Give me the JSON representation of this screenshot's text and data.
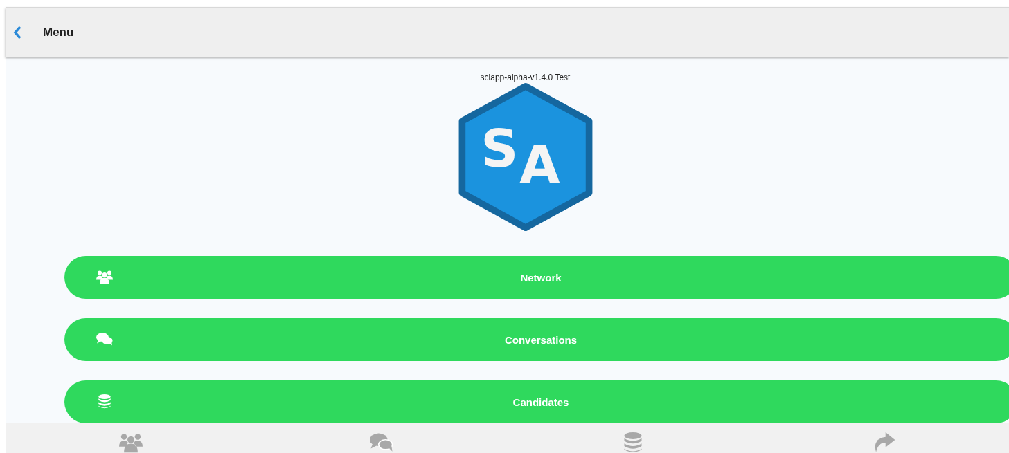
{
  "header": {
    "title": "Menu"
  },
  "app": {
    "version": "sciapp-alpha-v1.4.0 Test",
    "logo_letters": [
      "S",
      "A"
    ]
  },
  "menu_items": [
    {
      "label": "Network",
      "kind": "people"
    },
    {
      "label": "Conversations",
      "kind": "chat"
    },
    {
      "label": "Candidates",
      "kind": "database"
    }
  ],
  "tab_bar": [
    {
      "kind": "people"
    },
    {
      "kind": "chat"
    },
    {
      "kind": "database"
    },
    {
      "kind": "share"
    }
  ]
}
